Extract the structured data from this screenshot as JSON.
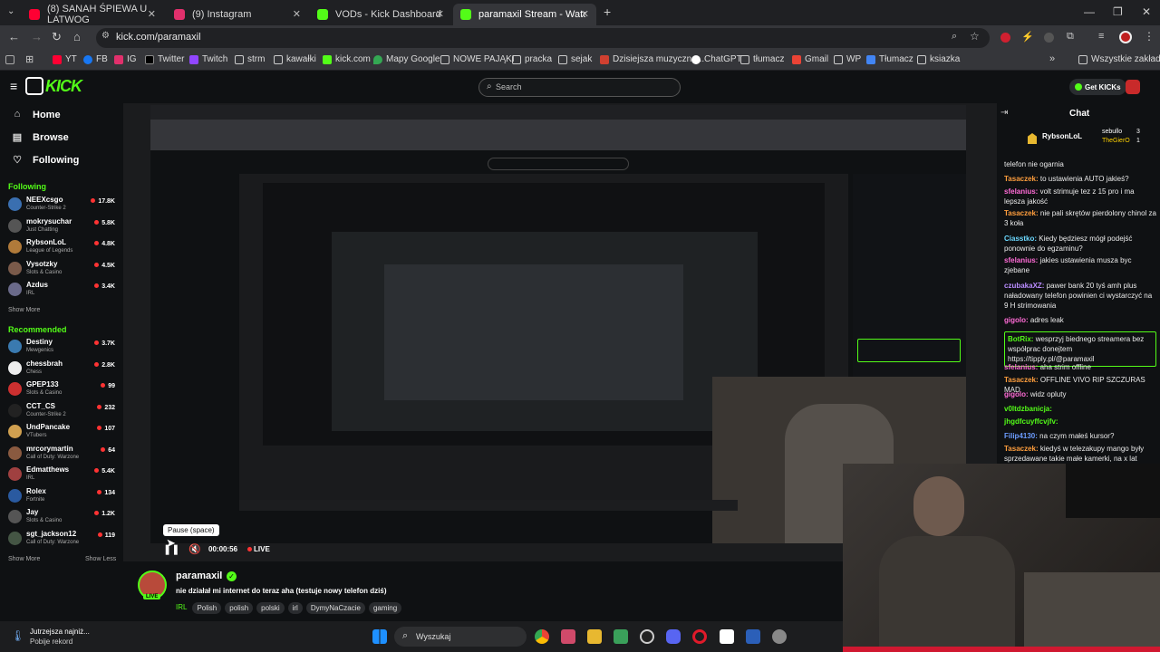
{
  "browser": {
    "tabs": [
      {
        "label": "(8) SANAH ŚPIEWA U LATWOG",
        "color": "#ff0033"
      },
      {
        "label": "(9) Instagram",
        "color": "#e1306c"
      },
      {
        "label": "VODs - Kick Dashboard",
        "color": "#53fc18"
      },
      {
        "label": "paramaxil Stream - Watch Live",
        "color": "#53fc18"
      }
    ],
    "new_tab": "+",
    "url": "kick.com/paramaxil",
    "bookmarks": [
      "YT",
      "FB",
      "IG",
      "Twitter",
      "Twitch",
      "strm",
      "kawałki",
      "kick.com",
      "Mapy Google",
      "NOWE PAJĄKI",
      "pracka",
      "sejak",
      "Dzisiejsza muzyczna...",
      "ChatGPT",
      "tłumacz",
      "Gmail",
      "WP",
      "Tłumacz",
      "ksiazka"
    ],
    "all_bookmarks": "Wszystkie zakładki"
  },
  "kick": {
    "logo": "KICK",
    "search_placeholder": "Search",
    "get_kicks": "Get KICKs",
    "nav": [
      {
        "label": "Home",
        "icon": "home-icon"
      },
      {
        "label": "Browse",
        "icon": "browse-icon"
      },
      {
        "label": "Following",
        "icon": "heart-icon"
      }
    ],
    "following_title": "Following",
    "following": [
      {
        "name": "NEEXcsgo",
        "category": "Counter-Strike 2",
        "viewers": "17.8K",
        "color": "#3a6fb0"
      },
      {
        "name": "mokrysuchar",
        "category": "Just Chatting",
        "viewers": "5.8K",
        "color": "#555555"
      },
      {
        "name": "RybsonLoL",
        "category": "League of Legends",
        "viewers": "4.8K",
        "color": "#b07a3a"
      },
      {
        "name": "Vysotzky",
        "category": "Slots & Casino",
        "viewers": "4.5K",
        "color": "#7a5a4a"
      },
      {
        "name": "Azdus",
        "category": "IRL",
        "viewers": "3.4K",
        "color": "#6a6a8a"
      }
    ],
    "show_more": "Show More",
    "recommended_title": "Recommended",
    "recommended": [
      {
        "name": "Destiny",
        "category": "Mewgenics",
        "viewers": "3.7K",
        "color": "#3a7ab0"
      },
      {
        "name": "chessbrah",
        "category": "Chess",
        "viewers": "2.8K",
        "color": "#eeeeee"
      },
      {
        "name": "GPEP133",
        "category": "Slots & Casino",
        "viewers": "99",
        "color": "#cc3030"
      },
      {
        "name": "CCT_CS",
        "category": "Counter-Strike 2",
        "viewers": "232",
        "color": "#222222"
      },
      {
        "name": "UndPancake",
        "category": "VTubers",
        "viewers": "107",
        "color": "#d0a050"
      },
      {
        "name": "mrcorymartin",
        "category": "Call of Duty: Warzone",
        "viewers": "64",
        "color": "#8a5a40"
      },
      {
        "name": "Edmatthews",
        "category": "IRL",
        "viewers": "5.4K",
        "color": "#a04040"
      },
      {
        "name": "Rolex",
        "category": "Fortnite",
        "viewers": "134",
        "color": "#2a5aa0"
      },
      {
        "name": "Jay",
        "category": "Slots & Casino",
        "viewers": "1.2K",
        "color": "#555555"
      },
      {
        "name": "sgt_jackson12",
        "category": "Call of Duty: Warzone",
        "viewers": "119",
        "color": "#445544"
      }
    ],
    "show_less": "Show Less"
  },
  "player": {
    "tooltip": "Pause (space)",
    "time": "00:00:56",
    "live": "LIVE"
  },
  "stream": {
    "streamer": "paramaxil",
    "title": "nie działał mi internet do teraz aha (testuje nowy telefon dziś)",
    "category": "IRL",
    "tags": [
      "Polish",
      "polish",
      "polski",
      "irl",
      "DymyNaCzacie",
      "gaming"
    ],
    "live_badge": "LIVE"
  },
  "chat": {
    "title": "Chat",
    "top": [
      {
        "name": "RybsonLoL",
        "color": "#ffffff"
      },
      {
        "name": "sebullo",
        "count": "3",
        "color": "#ffffff"
      },
      {
        "name": "TheGierO",
        "count": "1",
        "color": "#ffd200"
      }
    ],
    "messages": [
      {
        "user": "",
        "text": "telefon nie ogarnia",
        "color": "#eaeaea"
      },
      {
        "user": "Tasaczek:",
        "text": "to ustawienia AUTO jakieś?",
        "color": "#ff9e3d"
      },
      {
        "user": "sfelanius:",
        "text": "volt strimuje tez z 15 pro i ma lepsza jakość",
        "color": "#ff6bd6"
      },
      {
        "user": "Tasaczek:",
        "text": "nie pali skrętów pierdolony chinol za 3 koła",
        "color": "#ff9e3d"
      },
      {
        "user": "Ciasstko:",
        "text": "Kiedy będziesz mógł podejść ponownie do egzaminu?",
        "color": "#6cd9ff"
      },
      {
        "user": "sfelanius:",
        "text": "jakies ustawienia musza byc zjebane",
        "color": "#ff6bd6"
      },
      {
        "user": "czubakaXZ:",
        "text": "pawer bank 20 tyś amh plus naładowany telefon powinien ci wystarczyć na 9 H strimowania",
        "color": "#b98cff"
      },
      {
        "user": "gigolo:",
        "text": "adres leak",
        "color": "#ff6bd6"
      },
      {
        "user": "BotRix:",
        "text": "wesprzyj biednego streamera bez współprac donejtem https://tipply.pl/@paramaxil",
        "color": "#53fc18"
      },
      {
        "user": "sfelanius:",
        "text": "aha strim offline",
        "color": "#ff6bd6"
      },
      {
        "user": "Tasaczek:",
        "text": "OFFLINE VIVO RIP SZCZURAS MAD",
        "color": "#ff9e3d"
      },
      {
        "user": "gigolo:",
        "text": "widz opluty",
        "color": "#ff6bd6"
      },
      {
        "user": "v0ltdzbanicja:",
        "text": "",
        "color": "#53fc18"
      },
      {
        "user": "jhgdfcuyffcvjfv:",
        "text": "",
        "color": "#53fc18"
      },
      {
        "user": "Filip4130:",
        "text": "na czym małeś kursor?",
        "color": "#6c9cff"
      },
      {
        "user": "Tasaczek:",
        "text": "kiedyś w telezakupy mango były sprzedawane takie małe kamerki, na x lat przed",
        "color": "#ff9e3d"
      }
    ]
  },
  "taskbar": {
    "weather_line1": "Jutrzejsza najniż...",
    "weather_line2": "Pobije rekord",
    "search": "Wyszukaj"
  }
}
